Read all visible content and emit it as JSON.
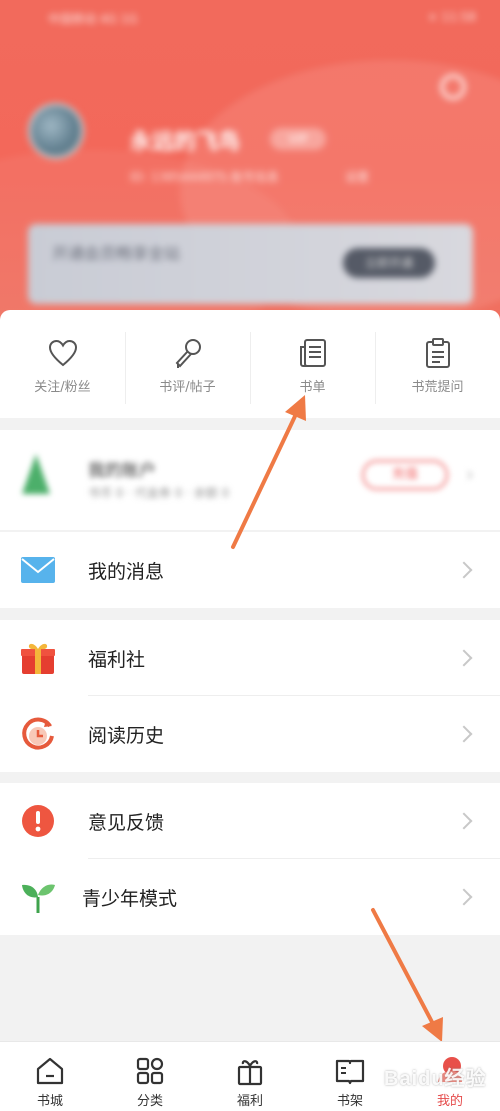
{
  "status_bar": {
    "carrier": "中国移动 4G 1G",
    "right": "× 11:58"
  },
  "profile": {
    "username": "永远的飞鸟",
    "badge": "VIP",
    "sub_text": "ID: 1385444975 账号信息",
    "sub_right": "设置",
    "vip_banner": "开通会员畅享全站",
    "vip_button": "立即开通"
  },
  "quick_links": [
    {
      "label": "关注/粉丝",
      "icon": "heart-icon"
    },
    {
      "label": "书评/帖子",
      "icon": "microphone-icon"
    },
    {
      "label": "书单",
      "icon": "booklist-icon"
    },
    {
      "label": "书荒提问",
      "icon": "clipboard-icon"
    }
  ],
  "account": {
    "title": "我的账户",
    "sub": "书币 0 · 代金券 0 · 余额 0",
    "button": "充值"
  },
  "menu": {
    "messages": {
      "label": "我的消息",
      "icon": "envelope-icon"
    },
    "welfare": {
      "label": "福利社",
      "icon": "gift-icon"
    },
    "history": {
      "label": "阅读历史",
      "icon": "clock-history-icon"
    },
    "feedback": {
      "label": "意见反馈",
      "icon": "exclamation-icon"
    },
    "youth": {
      "label": "青少年模式",
      "icon": "sprout-icon"
    }
  },
  "tabs": [
    {
      "label": "书城",
      "icon": "home-icon"
    },
    {
      "label": "分类",
      "icon": "grid-icon"
    },
    {
      "label": "福利",
      "icon": "gift-box-icon"
    },
    {
      "label": "书架",
      "icon": "bookshelf-icon"
    },
    {
      "label": "我的",
      "icon": "profile-icon",
      "active": true
    }
  ],
  "watermark": "Baidu经验",
  "colors": {
    "header": "#f26a5c",
    "accent": "#e54b4b",
    "arrow": "#ef7a45"
  }
}
